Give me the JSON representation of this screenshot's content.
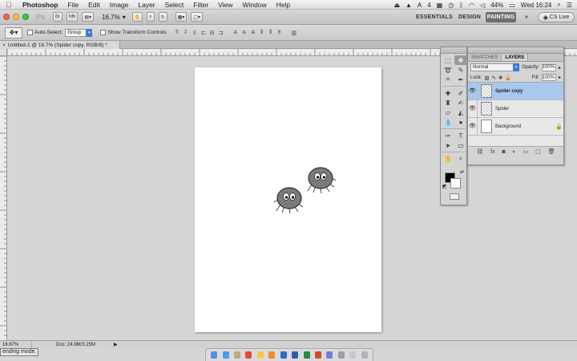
{
  "menubar": {
    "apple": "",
    "items": [
      "Photoshop",
      "File",
      "Edit",
      "Image",
      "Layer",
      "Select",
      "Filter",
      "View",
      "Window",
      "Help"
    ],
    "status": {
      "input_source": "A",
      "keyboard": "4",
      "battery": "44%",
      "clock": "Wed 16:24"
    }
  },
  "appbar": {
    "ps_label": "Ps",
    "bridge_label": "Br",
    "mini_label": "Mb",
    "zoom": "16.7%",
    "workspaces": [
      "ESSENTIALS",
      "DESIGN",
      "PAINTING"
    ],
    "active_workspace": "PAINTING",
    "cslive": "CS Live"
  },
  "options": {
    "auto_select_label": "Auto-Select:",
    "auto_select_value": "Group",
    "show_transform_label": "Show Transform Controls"
  },
  "document_tab": {
    "title": "Untitled-1 @ 16.7% (Spider copy, RGB/8) *"
  },
  "statusbar": {
    "zoom": "16.67%",
    "doc": "Doc: 24.9M/3.25M"
  },
  "tooltip": "ending mode.",
  "layers_panel": {
    "tabs": [
      "SWATCHES",
      "LAYERS"
    ],
    "active_tab": "LAYERS",
    "blend_mode": "Normal",
    "opacity_label": "Opacity:",
    "opacity": "100%",
    "lock_label": "Lock:",
    "fill_label": "Fill:",
    "fill": "100%",
    "layers": [
      {
        "name": "Spider copy",
        "selected": true
      },
      {
        "name": "Spider",
        "selected": false
      },
      {
        "name": "Background",
        "selected": false
      }
    ]
  },
  "colors": {
    "foreground": "#000000",
    "background": "#ffffff",
    "selected_layer": "#a9c8ef",
    "workspace_active": "#6f6f6f",
    "accent": "#3a7bd5",
    "spider_body": "#7a7a7a"
  }
}
